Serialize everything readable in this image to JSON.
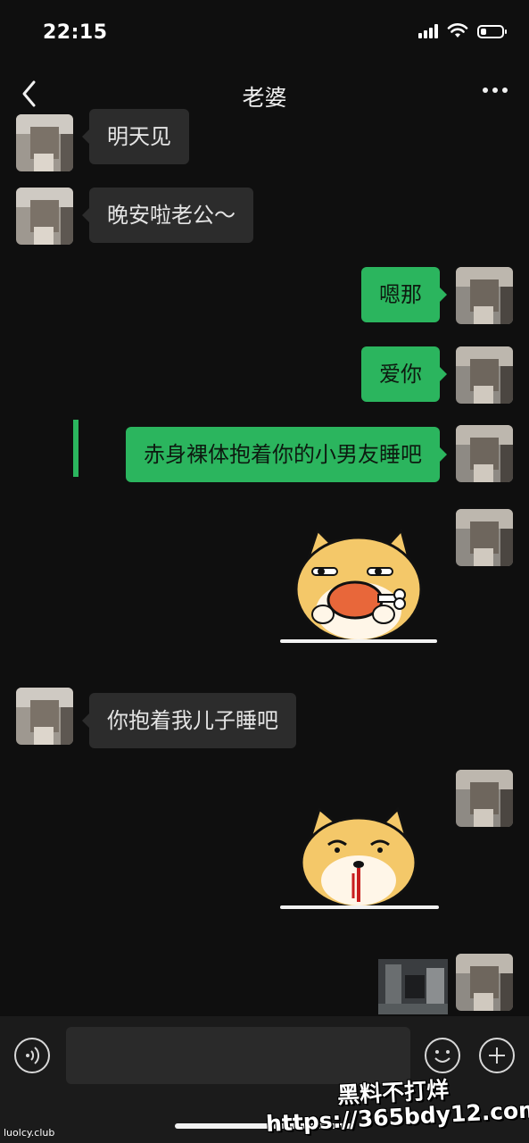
{
  "status_bar": {
    "time": "22:15"
  },
  "nav": {
    "title": "老婆"
  },
  "messages": [
    {
      "side": "in",
      "type": "text",
      "text": "明天见"
    },
    {
      "side": "in",
      "type": "text",
      "text": "晚安啦老公～"
    },
    {
      "side": "out",
      "type": "text",
      "text": "嗯那"
    },
    {
      "side": "out",
      "type": "text",
      "text": "爱你"
    },
    {
      "side": "out",
      "type": "text",
      "text": "赤身裸体抱着你的小男友睡吧"
    },
    {
      "side": "out",
      "type": "sticker",
      "icon": "shiba-eating-drumstick-sticker"
    },
    {
      "side": "in",
      "type": "text",
      "text": "你抱着我儿子睡吧"
    },
    {
      "side": "out",
      "type": "sticker",
      "icon": "shiba-nosebleed-sticker"
    },
    {
      "side": "out",
      "type": "image",
      "icon": "photo-thumbnail"
    }
  ],
  "watermarks": {
    "site_small": "luolcy.club",
    "line1": "黑料不打烊",
    "line2": "https://365bdy12.com"
  },
  "colors": {
    "sent_bubble": "#2bb55e",
    "received_bubble": "#2c2c2c",
    "background": "#0f0f0f"
  }
}
